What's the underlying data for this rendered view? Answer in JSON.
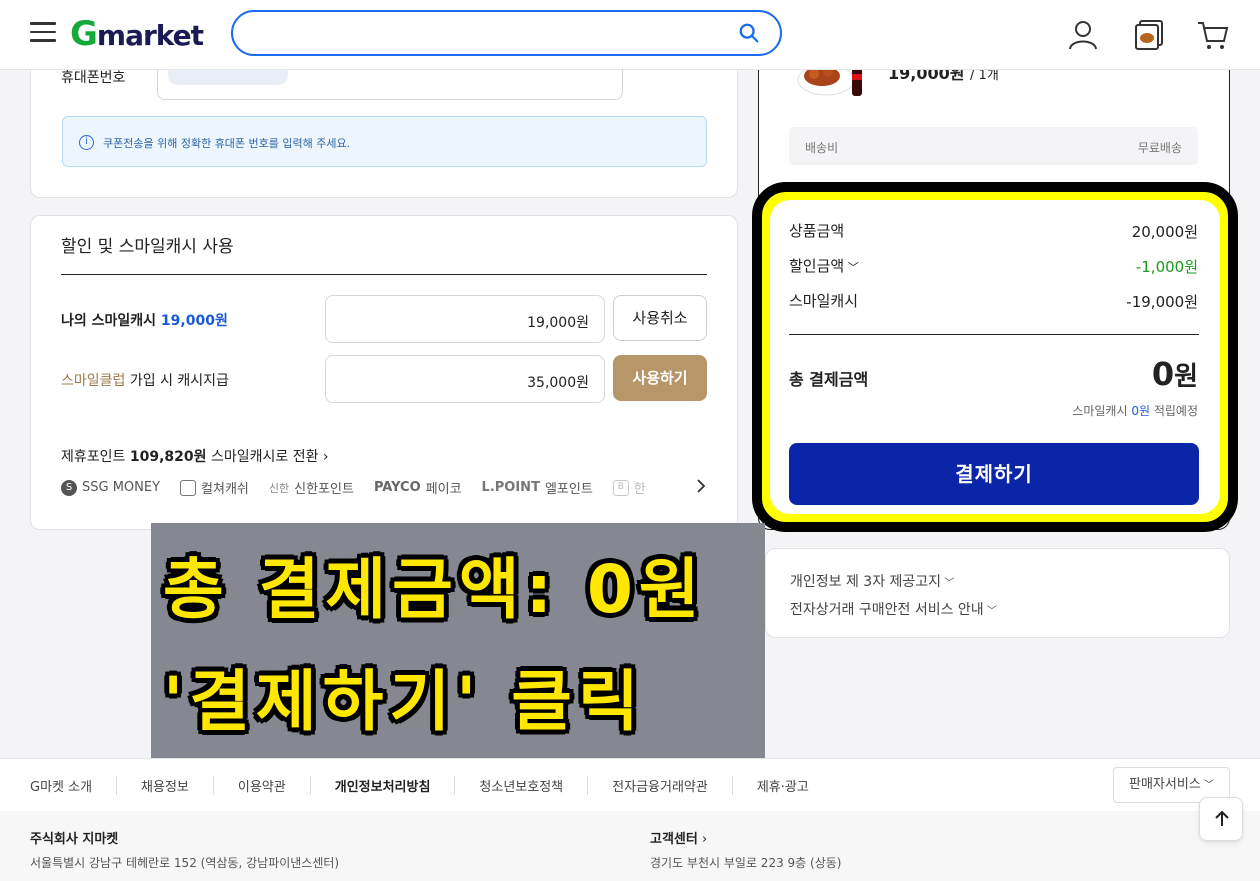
{
  "header": {
    "logo_g": "G",
    "logo_rest": "market",
    "search_placeholder": ""
  },
  "phone": {
    "label": "휴대폰번호",
    "notice": "쿠폰전송을 위해 정확한 휴대폰 번호를 입력해 주세요."
  },
  "discount": {
    "title": "할인 및 스마일캐시 사용",
    "my_cash_label": "나의 스마일캐시",
    "my_cash_amount": "19,000원",
    "my_cash_input": "19,000원",
    "cancel_button": "사용취소",
    "club_label_highlight": "스마일클럽",
    "club_label_rest": "가입 시 캐시지급",
    "club_input": "35,000원",
    "use_button": "사용하기",
    "points_prefix": "제휴포인트",
    "points_amount": "109,820원",
    "points_suffix": "스마일캐시로 전환",
    "partners": [
      {
        "icon": "S",
        "name": "SSG MONEY"
      },
      {
        "icon": "",
        "name": "컬쳐캐쉬"
      },
      {
        "icon": "신한",
        "name": "신한포인트"
      },
      {
        "icon": "PAYCO",
        "name": "페이코"
      },
      {
        "icon": "L.POINT",
        "name": "엘포인트"
      },
      {
        "icon": "B",
        "name": "한"
      }
    ]
  },
  "order": {
    "item_price": "19,000원",
    "item_qty": "/ 1개",
    "shipping_label": "배송비",
    "shipping_value": "무료배송",
    "product_amount_label": "상품금액",
    "product_amount": "20,000원",
    "discount_label": "할인금액",
    "discount_amount": "-1,000원",
    "cash_label": "스마일캐시",
    "cash_amount": "-19,000원",
    "total_label": "총 결제금액",
    "total_amount": "0",
    "total_unit": "원",
    "reward_prefix": "스마일캐시",
    "reward_amount": "0원",
    "reward_suffix": "적립예정",
    "pay_button": "결제하기"
  },
  "info": {
    "privacy": "개인정보 제 3자 제공고지",
    "safety": "전자상거래 구매안전 서비스 안내"
  },
  "overlay": {
    "line1": "총 결제금액: 0원",
    "line2": "'결제하기' 클릭"
  },
  "footer": {
    "links": [
      "G마켓 소개",
      "채용정보",
      "이용약관",
      "개인정보처리방침",
      "청소년보호정책",
      "전자금융거래약관",
      "제휴·광고"
    ],
    "seller_button": "판매자서비스",
    "company": "주식회사 지마켓",
    "address": "서울특별시 강남구 테헤란로 152 (역삼동, 강남파이낸스센터)",
    "cs_title": "고객센터",
    "cs_address": "경기도 부천시 부일로 223 9층 (상동)"
  },
  "colors": {
    "brand_green": "#15a93a",
    "primary_blue": "#0a25a8",
    "gold": "#b79669",
    "highlight_yellow": "#ffff00"
  }
}
